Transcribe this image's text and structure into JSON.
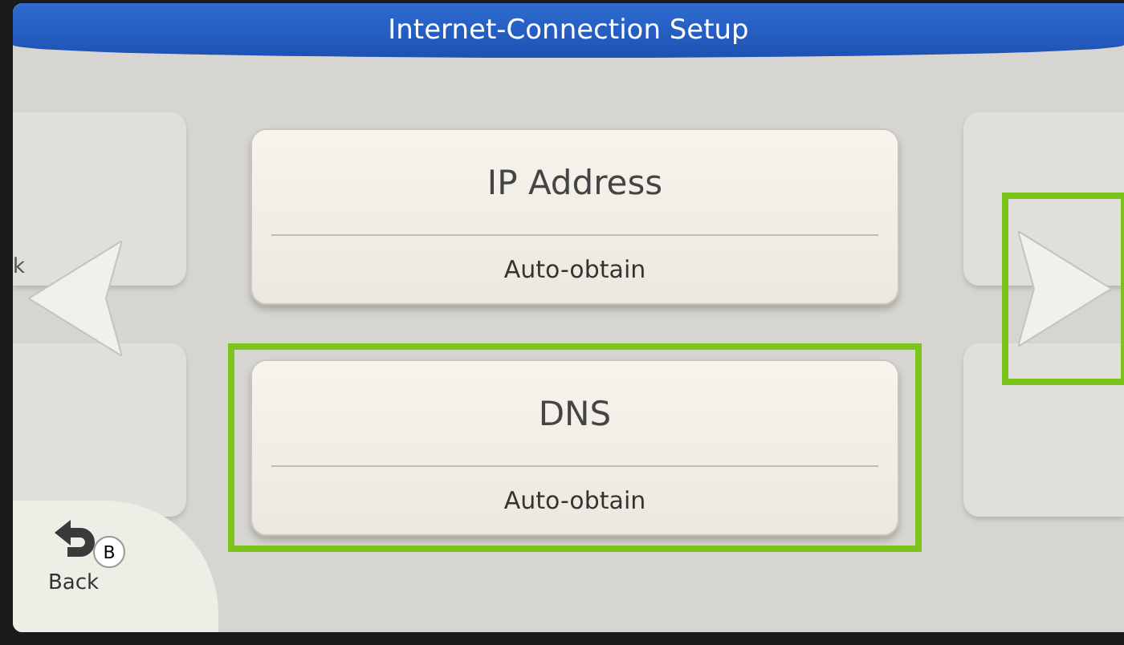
{
  "title": "Internet-Connection Setup",
  "settings": [
    {
      "label": "IP Address",
      "value": "Auto-obtain",
      "highlighted": false
    },
    {
      "label": "DNS",
      "value": "Auto-obtain",
      "highlighted": true
    }
  ],
  "arrows": [
    {
      "kind": "left",
      "highlighted": false
    },
    {
      "kind": "right",
      "highlighted": true
    }
  ],
  "edge_text": "k",
  "back": {
    "label": "Back",
    "button_key": "B"
  }
}
